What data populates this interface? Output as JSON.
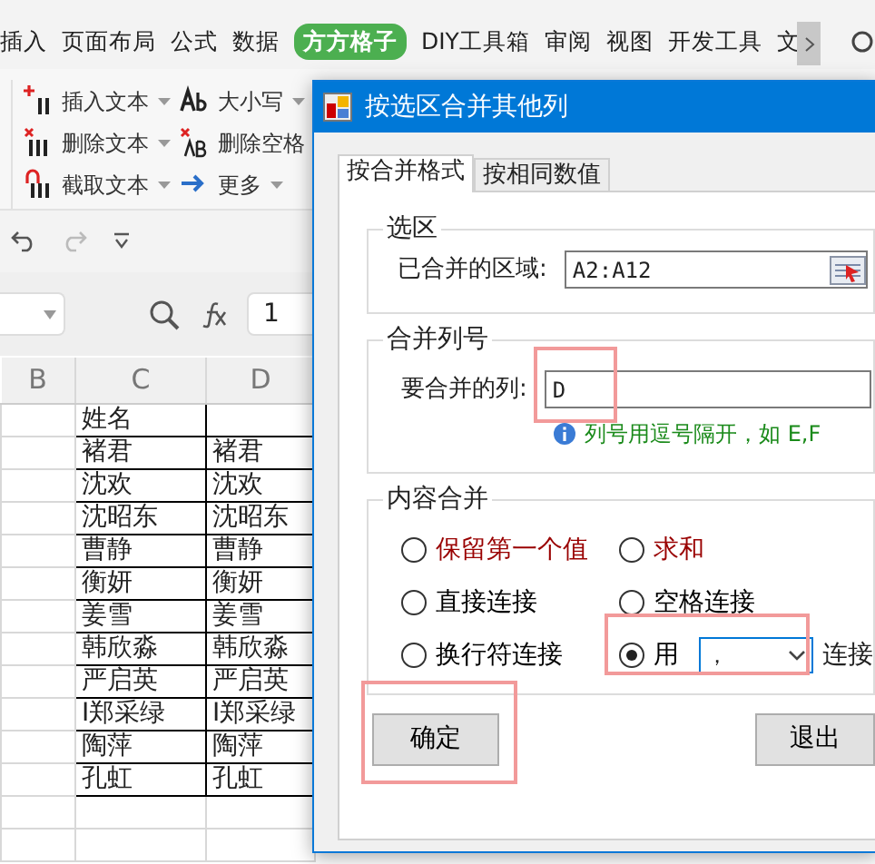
{
  "ribbon_tabs": [
    {
      "label": "插入",
      "selected": false
    },
    {
      "label": "页面布局",
      "selected": false
    },
    {
      "label": "公式",
      "selected": false
    },
    {
      "label": "数据",
      "selected": false
    },
    {
      "label": "方方格子",
      "selected": true
    },
    {
      "label": "DIY工具箱",
      "selected": false
    },
    {
      "label": "审阅",
      "selected": false
    },
    {
      "label": "视图",
      "selected": false
    },
    {
      "label": "开发工具",
      "selected": false
    },
    {
      "label": "文",
      "selected": false
    }
  ],
  "ribbon_buttons": [
    {
      "kind": "insert",
      "label": "插入文本",
      "dropdown": true
    },
    {
      "kind": "delete",
      "label": "删除文本",
      "dropdown": true
    },
    {
      "kind": "extract",
      "label": "截取文本",
      "dropdown": true
    },
    {
      "kind": "case",
      "label": "大小写",
      "dropdown": true
    },
    {
      "kind": "remove-space",
      "label": "删除空格",
      "dropdown": false
    },
    {
      "kind": "more",
      "label": "更多",
      "dropdown": true
    }
  ],
  "formula_bar": {
    "value": "1"
  },
  "sheet": {
    "columns": [
      "B",
      "C",
      "D"
    ],
    "rows": [
      {
        "C": "姓名"
      },
      {
        "C": "褚君",
        "D": "褚君"
      },
      {
        "C": "沈欢",
        "D": "沈欢"
      },
      {
        "C": "沈昭东",
        "D": "沈昭东"
      },
      {
        "C": "曹静",
        "D": "曹静"
      },
      {
        "C": "衡妍",
        "D": "衡妍"
      },
      {
        "C": "姜雪",
        "D": "姜雪"
      },
      {
        "C": "韩欣淼",
        "D": "韩欣淼"
      },
      {
        "C": "严启英",
        "D": "严启英"
      },
      {
        "C": "I郑采绿",
        "D": "I郑采绿"
      },
      {
        "C": "陶萍",
        "D": "陶萍"
      },
      {
        "C": "孔虹",
        "D": "孔虹"
      }
    ]
  },
  "dialog": {
    "title": "按选区合并其他列",
    "tabs": [
      {
        "label": "按合并格式",
        "selected": true
      },
      {
        "label": "按相同数值",
        "selected": false
      }
    ],
    "selection_group": {
      "title": "选区",
      "label": "已合并的区域:",
      "value": "A2:A12"
    },
    "column_group": {
      "title": "合并列号",
      "label": "要合并的列:",
      "value": "D",
      "hint": "列号用逗号隔开，如 E,F"
    },
    "content_group": {
      "title": "内容合并",
      "options": [
        {
          "kind": "plain",
          "label": "保留第一个值",
          "selected": false,
          "color": "#990000"
        },
        {
          "kind": "plain",
          "label": "求和",
          "selected": false,
          "color": "#990000"
        },
        {
          "kind": "plain",
          "label": "直接连接",
          "selected": false,
          "color": "#000000"
        },
        {
          "kind": "plain",
          "label": "空格连接",
          "selected": false,
          "color": "#000000"
        },
        {
          "kind": "plain",
          "label": "换行符连接",
          "selected": false,
          "color": "#000000"
        },
        {
          "kind": "separator",
          "label": "用",
          "selected": true,
          "color": "#000000",
          "separator": "，",
          "suffix": "连接"
        }
      ]
    },
    "buttons": [
      {
        "label": "确定"
      },
      {
        "label": "退出"
      }
    ]
  }
}
